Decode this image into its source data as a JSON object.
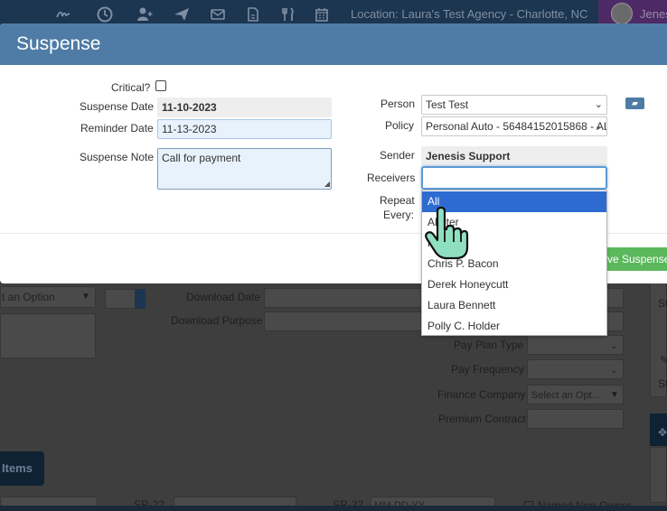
{
  "topbar": {
    "location": "Location: Laura's Test Agency - Charlotte, NC",
    "user_name": "Jenes",
    "icons": [
      "signature-icon",
      "clock-icon",
      "user-plus-icon",
      "paper-plane-icon",
      "envelope-icon",
      "file-icon",
      "utensils-icon",
      "calendar-icon"
    ]
  },
  "modal": {
    "title": "Suspense",
    "critical_label": "Critical?",
    "suspense_date_label": "Suspense Date",
    "suspense_date_value": "11-10-2023",
    "reminder_date_label": "Reminder Date",
    "reminder_date_value": "11-13-2023",
    "suspense_note_label": "Suspense Note",
    "suspense_note_value": "Call for payment",
    "person_label": "Person",
    "person_value": "Test Test",
    "policy_label": "Policy",
    "policy_value": "Personal Auto - 56484152015868 - AL",
    "sender_label": "Sender",
    "sender_value": "Jenesis Support",
    "receivers_label": "Receivers",
    "repeat_label_1": "Repeat",
    "repeat_label_2": "Every:",
    "save_label": "ve Suspense"
  },
  "receivers_dropdown": {
    "options": [
      "All",
      "Al   eter",
      "   nal",
      "Chris P. Bacon",
      "Derek Honeycutt",
      "Laura Bennett",
      "Polly C. Holder"
    ],
    "selected_index": 0
  },
  "background": {
    "option_placeholder": "t an Option",
    "download_date_label": "Download Date",
    "download_purpose_label": "Download Purpose",
    "pay_plan_type_label": "Pay Plan Type",
    "pay_frequency_label": "Pay Frequency",
    "finance_company_label": "Finance Company",
    "finance_company_placeholder": "Select an Opt...",
    "premium_contract_label": "Premium Contract",
    "items_tab": "Items",
    "sr22_label_1": "SR-22",
    "sr22_label_2": "SR-22",
    "sr22_placeholder": "MM-DD-YY",
    "named_non_owner_label": "Named Non-Owner",
    "right_panel_letter_1": "St",
    "right_panel_letter_2": "St"
  },
  "colors": {
    "modal_header": "#4f7ca6",
    "selected_option": "#2e6bd1",
    "save_button": "#5cb85c",
    "topbar": "#1c3550",
    "user_block": "#4d2a66"
  }
}
